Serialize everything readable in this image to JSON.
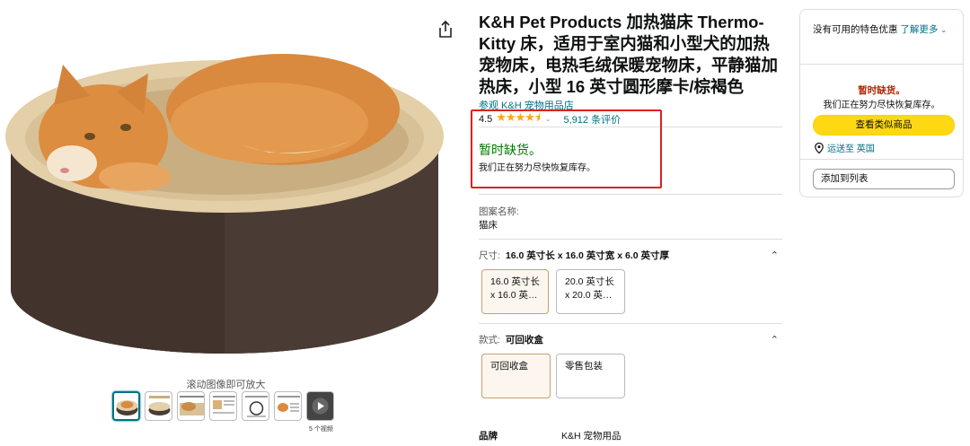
{
  "gallery": {
    "zoom_hint": "滚动图像即可放大",
    "video_count": "5 个视频",
    "thumbnails": [
      "thumb-1",
      "thumb-2",
      "thumb-3",
      "thumb-4",
      "thumb-5",
      "thumb-6",
      "thumb-video"
    ]
  },
  "product": {
    "title": "K&H Pet Products 加热猫床 Thermo-Kitty 床，适用于室内猫和小型犬的加热宠物床，电热毛绒保暖宠物床，平静猫加热床，小型 16 英寸圆形摩卡/棕褐色",
    "store_link": "参观 K&H 宠物用品店",
    "rating": "4.5",
    "rating_value": 4.5,
    "stars": "★★★★⯨",
    "review_count": "5,912 条评价",
    "availability_title": "暂时缺货。",
    "availability_text": "我们正在努力尽快恢复库存。",
    "pattern_label": "图案名称:",
    "pattern_value": "猫床",
    "size_label": "尺寸:",
    "size_value": "16.0 英寸长 x 16.0 英寸宽 x 6.0 英寸厚",
    "size_options": [
      {
        "line1": "16.0 英寸长",
        "line2": "x 16.0 英…"
      },
      {
        "line1": "20.0 英寸长",
        "line2": "x 20.0 英…"
      }
    ],
    "style_label": "款式:",
    "style_value": "可回收盒",
    "style_options": [
      "可回收盒",
      "零售包装"
    ],
    "brand_label": "品牌",
    "brand_value": "K&H 宠物用品"
  },
  "buybox": {
    "offer_text": "没有可用的特色优惠",
    "offer_link": "了解更多",
    "oos_title": "暂时缺货。",
    "oos_text": "我们正在努力尽快恢复库存。",
    "see_similar": "查看类似商品",
    "deliver_to": "运送至 英国",
    "add_to_list": "添加到列表"
  },
  "colors": {
    "link": "#007185",
    "in_stock_green": "#007600",
    "alert_red": "#e0201c",
    "button_yellow": "#ffd814",
    "star_orange": "#ffa41c"
  },
  "icons": [
    "share-icon",
    "star-icon",
    "chevron-down-icon",
    "chevron-up-icon",
    "location-pin-icon",
    "play-icon"
  ]
}
